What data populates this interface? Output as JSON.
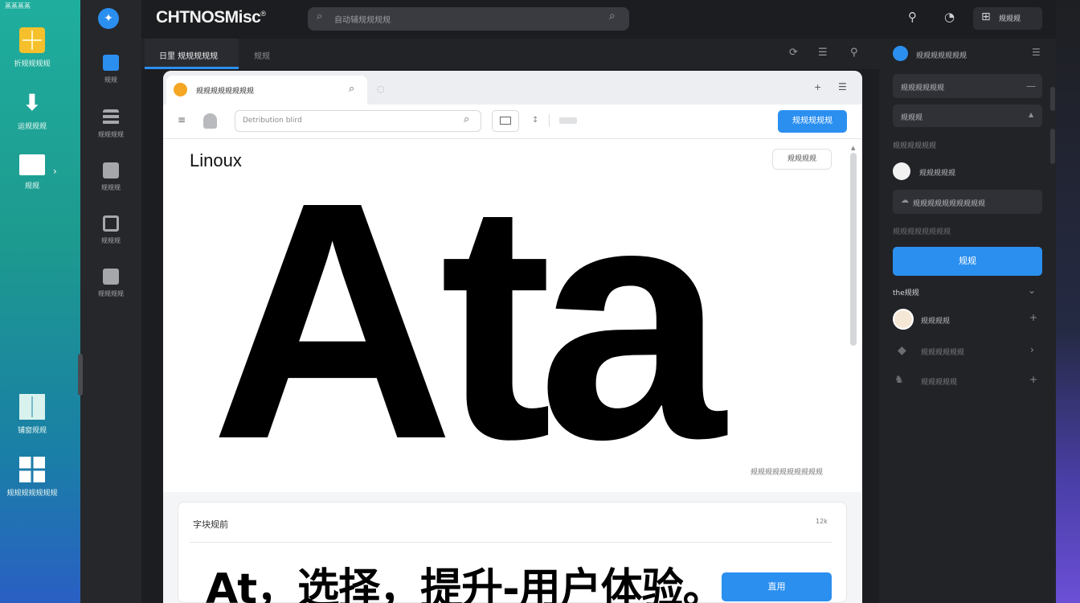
{
  "desktop": {
    "top_left_label": "蒸蒸蒸蒸",
    "icons": [
      {
        "label": "折规规规规",
        "icon": "folder-grid-icon",
        "color": "#f5c02b"
      },
      {
        "label": "运规规规",
        "icon": "download-icon",
        "color": "#ffffff"
      },
      {
        "label": "规规",
        "icon": "folder-icon",
        "color": "#ffffff"
      },
      {
        "label": "铺窗规规",
        "icon": "window-tiles-icon",
        "color": "#d9f2ee"
      },
      {
        "label": "规规规规规规规",
        "icon": "windows-grid-icon",
        "color": "#ffffff"
      }
    ]
  },
  "app": {
    "logo": "✦",
    "brand": "CHTNOSMisc",
    "brand_mark": "®",
    "search_placeholder": "自动辅规规规规",
    "top_button_label": "规规规",
    "rail": [
      {
        "label": "规规",
        "icon": "app-grid-icon",
        "color": "#2b8ff0"
      },
      {
        "label": "规规规规",
        "icon": "list-icon",
        "color": "#9a9ba0"
      },
      {
        "label": "规规规",
        "icon": "edit-icon",
        "color": "#9a9ba0"
      },
      {
        "label": "规规规",
        "icon": "calendar-icon",
        "color": "#9a9ba0"
      },
      {
        "label": "规规规规",
        "icon": "table-icon",
        "color": "#9a9ba0"
      }
    ],
    "tabs": [
      {
        "label": "日里 规规规规规"
      },
      {
        "label": "规规"
      }
    ]
  },
  "browser": {
    "tab_title": "规规规规规规规规",
    "url_placeholder": "Detribution blird",
    "blue_button": "规规规规规",
    "page_title": "Linoux",
    "outline_button": "规规规规",
    "hero_text": "Ata",
    "caption": "规规规规规规规规规规",
    "sub_label": "字块规前",
    "sub_count": "12k",
    "big_text": "At，选择，提升-用户体验。",
    "sub_button": "直用"
  },
  "right_panel": {
    "header": "规规规规规规规",
    "field1": "规规规规规规",
    "select1": "规规规",
    "section_label": "规规规规规规",
    "linked_item": "规规规规规",
    "field2": "规规规规规规规规规规",
    "hint": "规规规规规规规规",
    "blue_button": "规规",
    "group_title": "the规规",
    "members": [
      {
        "label": "规规规规"
      },
      {
        "label": "规规规规规规"
      },
      {
        "label": "规规规规规"
      }
    ]
  }
}
